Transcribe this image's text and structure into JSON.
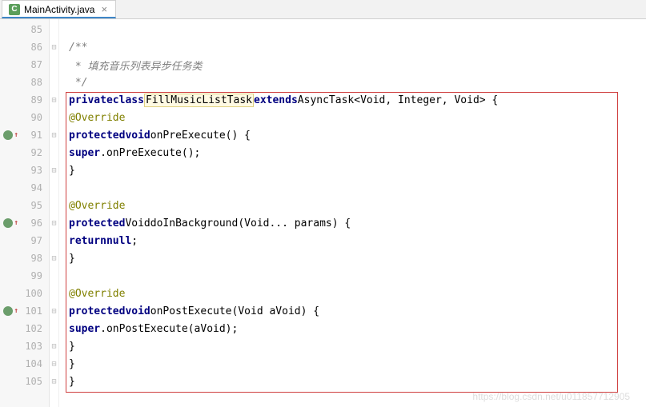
{
  "tab": {
    "icon_letter": "C",
    "filename": "MainActivity.java",
    "close": "×"
  },
  "code": {
    "lines": [
      {
        "n": "85",
        "fold": "",
        "marker": false
      },
      {
        "n": "86",
        "fold": "⊟",
        "marker": false
      },
      {
        "n": "87",
        "fold": "",
        "marker": false
      },
      {
        "n": "88",
        "fold": "",
        "marker": false
      },
      {
        "n": "89",
        "fold": "⊟",
        "marker": false
      },
      {
        "n": "90",
        "fold": "",
        "marker": false
      },
      {
        "n": "91",
        "fold": "⊟",
        "marker": true
      },
      {
        "n": "92",
        "fold": "",
        "marker": false
      },
      {
        "n": "93",
        "fold": "⊟",
        "marker": false
      },
      {
        "n": "94",
        "fold": "",
        "marker": false
      },
      {
        "n": "95",
        "fold": "",
        "marker": false
      },
      {
        "n": "96",
        "fold": "⊟",
        "marker": true
      },
      {
        "n": "97",
        "fold": "",
        "marker": false
      },
      {
        "n": "98",
        "fold": "⊟",
        "marker": false
      },
      {
        "n": "99",
        "fold": "",
        "marker": false
      },
      {
        "n": "100",
        "fold": "",
        "marker": false
      },
      {
        "n": "101",
        "fold": "⊟",
        "marker": true
      },
      {
        "n": "102",
        "fold": "",
        "marker": false
      },
      {
        "n": "103",
        "fold": "⊟",
        "marker": false
      },
      {
        "n": "104",
        "fold": "⊟",
        "marker": false
      },
      {
        "n": "105",
        "fold": "⊟",
        "marker": false
      }
    ],
    "comment_open": "/**",
    "comment_body": " * 填充音乐列表异步任务类",
    "comment_close": " */",
    "kw_private": "private",
    "kw_class": "class",
    "classname": "FillMusicListTask",
    "kw_extends": "extends",
    "supertype": "AsyncTask<Void, Integer, Void> {",
    "ann_override": "@Override",
    "kw_protected": "protected",
    "kw_void": "void",
    "type_Void": "Void",
    "m_onPreExecute": "onPreExecute() {",
    "s_onPreExecute": ".onPreExecute();",
    "kw_super": "super",
    "brace_close": "}",
    "m_doInBackground": "doInBackground(Void... params) {",
    "kw_return": "return",
    "kw_null": "null",
    "semicolon": ";",
    "m_onPostExecute": "onPostExecute(Void aVoid) {",
    "s_onPostExecute": ".onPostExecute(aVoid);"
  },
  "watermark": "https://blog.csdn.net/u011857712905"
}
